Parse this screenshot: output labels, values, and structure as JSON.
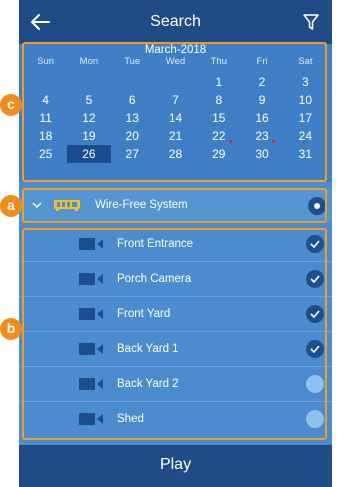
{
  "header": {
    "title": "Search"
  },
  "calendar": {
    "month": "March-2018",
    "weekdays": [
      "Sun",
      "Mon",
      "Tue",
      "Wed",
      "Thu",
      "Fri",
      "Sat"
    ],
    "days": [
      "",
      "",
      "",
      "",
      "1",
      "2",
      "3",
      "4",
      "5",
      "6",
      "7",
      "8",
      "9",
      "10",
      "11",
      "12",
      "13",
      "14",
      "15",
      "16",
      "17",
      "18",
      "19",
      "20",
      "21",
      "22",
      "23",
      "24",
      "25",
      "26",
      "27",
      "28",
      "29",
      "30",
      "31"
    ],
    "selected_day": "26",
    "recording_days": [
      "22",
      "23"
    ]
  },
  "device": {
    "name": "Wire-Free System",
    "selected": true
  },
  "cameras": [
    {
      "name": "Front Entrance",
      "checked": true
    },
    {
      "name": "Porch Camera",
      "checked": true
    },
    {
      "name": "Front Yard",
      "checked": true
    },
    {
      "name": "Back Yard 1",
      "checked": true
    },
    {
      "name": "Back Yard 2",
      "checked": false
    },
    {
      "name": "Shed",
      "checked": false
    }
  ],
  "footer": {
    "play_label": "Play"
  },
  "callouts": {
    "a": "a",
    "b": "b",
    "c": "c"
  },
  "colors": {
    "accent": "#f59a23",
    "header": "#1f4c86",
    "background": "#4b8ccf",
    "selected": "#1a4d8f",
    "record_dot": "#e02020"
  }
}
